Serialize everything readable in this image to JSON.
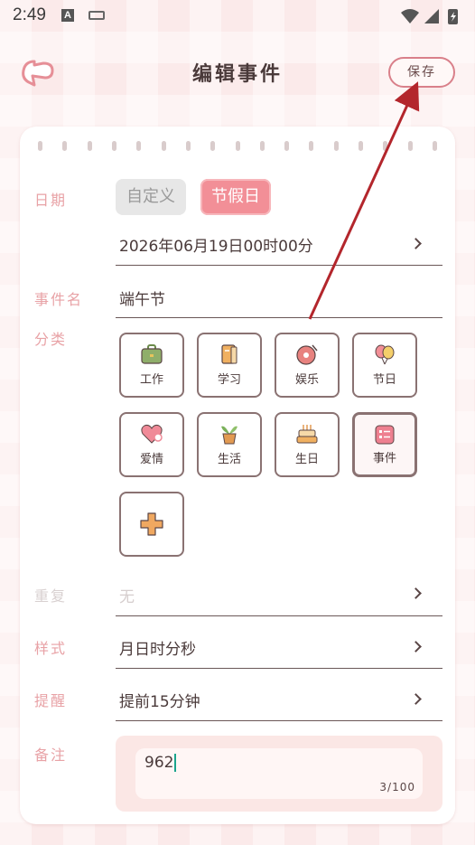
{
  "status": {
    "time": "2:49",
    "a_badge": "A"
  },
  "header": {
    "title": "编辑事件",
    "save_label": "保存"
  },
  "form": {
    "date": {
      "label": "日期",
      "options": [
        {
          "label": "自定义",
          "selected": false
        },
        {
          "label": "节假日",
          "selected": true
        }
      ],
      "value": "2026年06月19日00时00分"
    },
    "event_name": {
      "label": "事件名",
      "value": "端午节"
    },
    "category": {
      "label": "分类",
      "items": [
        {
          "label": "工作",
          "icon": "briefcase-icon"
        },
        {
          "label": "学习",
          "icon": "book-icon"
        },
        {
          "label": "娱乐",
          "icon": "record-icon"
        },
        {
          "label": "节日",
          "icon": "balloon-icon"
        },
        {
          "label": "爱情",
          "icon": "heart-icon"
        },
        {
          "label": "生活",
          "icon": "plant-icon"
        },
        {
          "label": "生日",
          "icon": "cake-icon"
        },
        {
          "label": "事件",
          "icon": "event-card-icon"
        }
      ],
      "selected": "事件",
      "add_icon": "plus-icon"
    },
    "repeat": {
      "label": "重复",
      "value": "无",
      "disabled": true
    },
    "style": {
      "label": "样式",
      "value": "月日时分秒"
    },
    "reminder": {
      "label": "提醒",
      "value": "提前15分钟"
    },
    "note": {
      "label": "备注",
      "value": "962",
      "counter": "3/100"
    }
  },
  "colors": {
    "accent": "#f28f97",
    "label": "#e8a2a6",
    "annotation_arrow": "#b3262c"
  }
}
